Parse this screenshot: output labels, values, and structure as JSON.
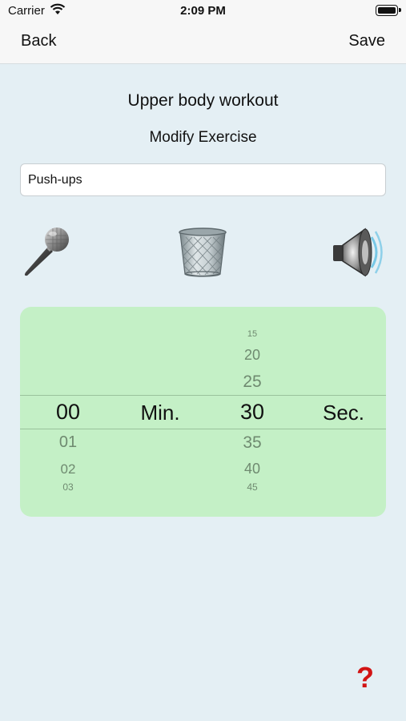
{
  "status_bar": {
    "carrier": "Carrier",
    "time": "2:09 PM"
  },
  "nav": {
    "back_label": "Back",
    "save_label": "Save"
  },
  "workout_title": "Upper body workout",
  "subtitle": "Modify Exercise",
  "exercise_input": {
    "value": "Push-ups"
  },
  "icons": {
    "microphone": "microphone-icon",
    "trash": "trash-can-icon",
    "speaker": "speaker-icon"
  },
  "picker": {
    "minutes": {
      "above": [],
      "selected": "00",
      "below": [
        "01",
        "02",
        "03"
      ]
    },
    "minutes_label": "Min.",
    "seconds": {
      "above": [
        "15",
        "20",
        "25"
      ],
      "selected": "30",
      "below": [
        "35",
        "40",
        "45"
      ]
    },
    "seconds_label": "Sec."
  },
  "help": {
    "label": "?"
  },
  "colors": {
    "background": "#e4eff4",
    "picker_bg": "#c4f0c6",
    "help": "#d21414"
  }
}
